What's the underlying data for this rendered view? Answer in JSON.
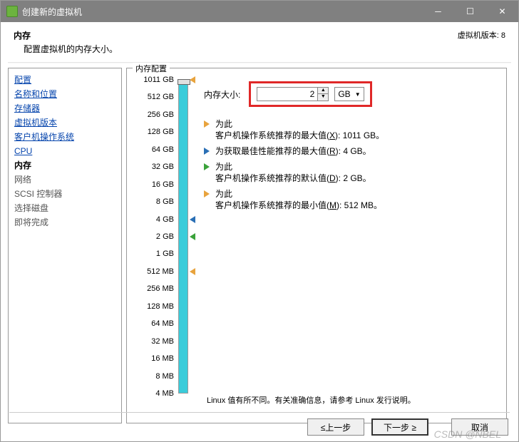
{
  "window": {
    "title": "创建新的虚拟机",
    "version_label": "虚拟机版本: 8"
  },
  "header": {
    "title": "内存",
    "subtitle": "配置虚拟机的内存大小。"
  },
  "nav": {
    "items": [
      {
        "label": "配置",
        "type": "link"
      },
      {
        "label": "名称和位置",
        "type": "link"
      },
      {
        "label": "存储器",
        "type": "link"
      },
      {
        "label": "虚拟机版本",
        "type": "link"
      },
      {
        "label": "客户机操作系统",
        "type": "link"
      },
      {
        "label": "CPU",
        "type": "link"
      },
      {
        "label": "内存",
        "type": "current"
      },
      {
        "label": "网络",
        "type": "plain"
      },
      {
        "label": "SCSI 控制器",
        "type": "plain"
      },
      {
        "label": "选择磁盘",
        "type": "plain"
      },
      {
        "label": "即将完成",
        "type": "plain"
      }
    ]
  },
  "memory": {
    "group_label": "内存配置",
    "size_label": "内存大小:",
    "size_value": "2",
    "unit": "GB",
    "ticks": [
      "1011 GB",
      "512 GB",
      "256 GB",
      "128 GB",
      "64 GB",
      "32 GB",
      "16 GB",
      "8 GB",
      "4 GB",
      "2 GB",
      "1 GB",
      "512 MB",
      "256 MB",
      "128 MB",
      "64 MB",
      "32 MB",
      "16 MB",
      "8 MB",
      "4 MB"
    ],
    "recs": [
      {
        "color": "orange",
        "text_a": "为此",
        "text_b": "客户机操作系统推荐的最大值(",
        "accel": "X",
        "text_c": "): 1011 GB。"
      },
      {
        "color": "blue",
        "text_a": "",
        "text_b": "为获取最佳性能推荐的最大值(",
        "accel": "R",
        "text_c": "): 4 GB。"
      },
      {
        "color": "green",
        "text_a": "为此",
        "text_b": "客户机操作系统推荐的默认值(",
        "accel": "D",
        "text_c": "): 2 GB。"
      },
      {
        "color": "orange",
        "text_a": "为此",
        "text_b": "客户机操作系统推荐的最小值(",
        "accel": "M",
        "text_c": "): 512 MB。"
      }
    ],
    "note": "Linux 值有所不同。有关准确信息，请参考 Linux 发行说明。"
  },
  "footer": {
    "back": "≤上一步",
    "next": "下一步 ≥",
    "cancel": "取消"
  },
  "watermark": "CSDN @NBEL"
}
